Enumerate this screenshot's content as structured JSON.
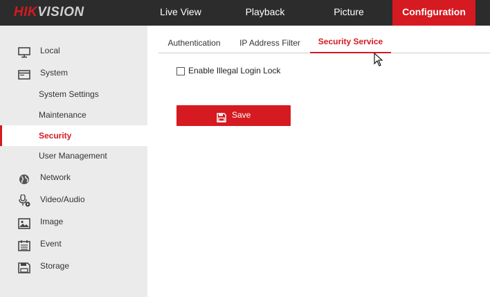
{
  "brand": {
    "part1": "HIK",
    "part2": "VISION"
  },
  "nav": {
    "live_view": "Live View",
    "playback": "Playback",
    "picture": "Picture",
    "configuration": "Configuration"
  },
  "sidebar": {
    "items": [
      {
        "label": "Local",
        "icon": "monitor-icon"
      },
      {
        "label": "System",
        "icon": "window-icon"
      },
      {
        "label": "System Settings"
      },
      {
        "label": "Maintenance"
      },
      {
        "label": "Security"
      },
      {
        "label": "User Management"
      },
      {
        "label": "Network",
        "icon": "globe-icon"
      },
      {
        "label": "Video/Audio",
        "icon": "microphone-icon"
      },
      {
        "label": "Image",
        "icon": "image-icon"
      },
      {
        "label": "Event",
        "icon": "calendar-icon"
      },
      {
        "label": "Storage",
        "icon": "floppy-disk-icon"
      }
    ]
  },
  "tabs": {
    "authentication": "Authentication",
    "ip_filter": "IP Address Filter",
    "security_service": "Security Service"
  },
  "form": {
    "illegal_login_lock_label": "Enable Illegal Login Lock",
    "illegal_login_lock_checked": false
  },
  "save_button": {
    "label": "Save",
    "icon": "floppy-disk-icon"
  },
  "colors": {
    "accent": "#d51a21",
    "topbar": "#2c2c2c",
    "sidebar": "#ebebeb"
  }
}
